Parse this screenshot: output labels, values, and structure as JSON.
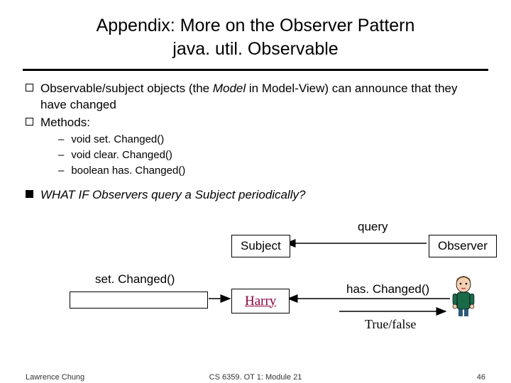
{
  "title": {
    "line1": "Appendix: More on the Observer Pattern",
    "line2": "java. util. Observable"
  },
  "bullets": {
    "b1_pre": "Observable/subject objects (the ",
    "b1_em": "Model",
    "b1_post": " in Model-View) can announce that they have changed",
    "b2": "Methods:",
    "m1": "void set. Changed()",
    "m2": "void clear. Changed()",
    "m3": "boolean has. Changed()",
    "b3": "WHAT IF Observers query a Subject periodically?"
  },
  "diagram": {
    "query": "query",
    "subject": "Subject",
    "observer": "Observer",
    "setChanged": "set. Changed()",
    "harry": "Harry",
    "hasChanged": "has. Changed()",
    "truefalse": "True/false"
  },
  "footer": {
    "author": "Lawrence Chung",
    "course": "CS 6359. OT 1: Module 21",
    "page": "46"
  }
}
